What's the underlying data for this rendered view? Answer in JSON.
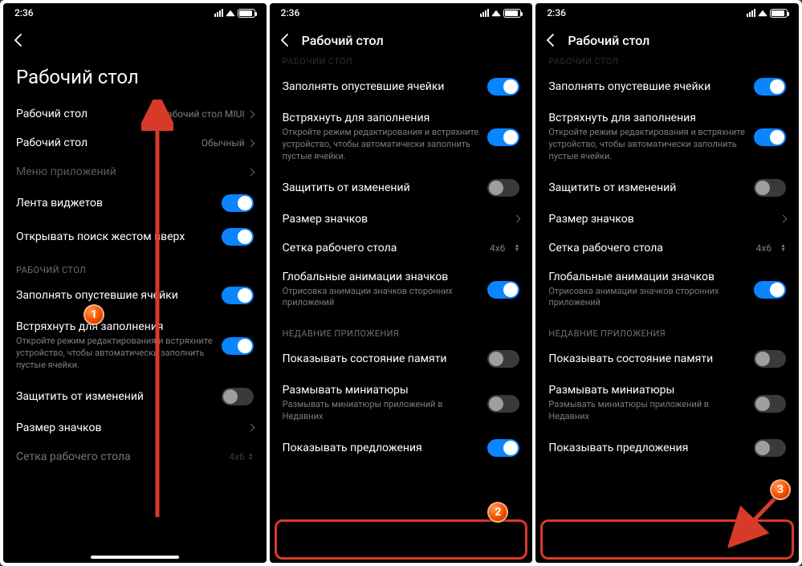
{
  "time": "2:36",
  "panel1": {
    "header": "Рабочий стол",
    "r1": {
      "label": "Рабочий стол",
      "value": "Рабочий стол MIUI"
    },
    "r2": {
      "label": "Рабочий стол",
      "value": "Обычный"
    },
    "r3": {
      "label": "Меню приложений"
    },
    "r4": {
      "label": "Лента виджетов"
    },
    "r5": {
      "label": "Открывать поиск жестом вверх"
    },
    "sec": "РАБОЧИЙ СТОЛ",
    "r6": {
      "label": "Заполнять опустевшие ячейки"
    },
    "r7": {
      "label": "Встряхнуть для заполнения",
      "sub": "Откройте режим редактирования и встряхните устройство, чтобы автоматически заполнить пустые ячейки."
    },
    "r8": {
      "label": "Защитить от изменений"
    },
    "r9": {
      "label": "Размер значков"
    },
    "r10": {
      "label": "Сетка рабочего стола",
      "value": "4x6"
    }
  },
  "common": {
    "header": "Рабочий стол",
    "secHs": "РАБОЧИЙ СТОЛ",
    "r1": {
      "label": "Заполнять опустевшие ячейки"
    },
    "r2": {
      "label": "Встряхнуть для заполнения",
      "sub": "Откройте режим редактирования и встряхните устройство, чтобы автоматически заполнить пустые ячейки."
    },
    "r3": {
      "label": "Защитить от изменений"
    },
    "r4": {
      "label": "Размер значков"
    },
    "r5": {
      "label": "Сетка рабочего стола",
      "value": "4x6"
    },
    "r6": {
      "label": "Глобальные анимации значков",
      "sub": "Отрисовка анимации значков сторонних приложений"
    },
    "secRecent": "НЕДАВНИЕ ПРИЛОЖЕНИЯ",
    "r7": {
      "label": "Показывать состояние памяти"
    },
    "r8": {
      "label": "Размывать миниатюры",
      "sub": "Размывать миниатюры приложений в Недавних"
    },
    "r9": {
      "label": "Показывать предложения"
    }
  },
  "badges": {
    "b1": "1",
    "b2": "2",
    "b3": "3"
  }
}
